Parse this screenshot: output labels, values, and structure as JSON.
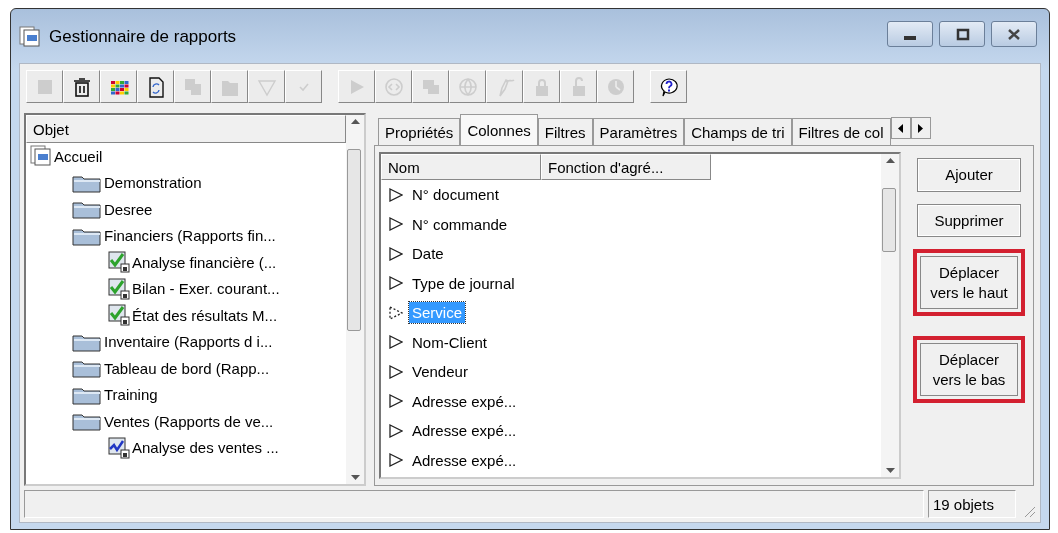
{
  "window": {
    "title": "Gestionnaire de rapports",
    "controls": [
      {
        "kind": "minimize"
      },
      {
        "kind": "maximize"
      },
      {
        "kind": "close"
      }
    ]
  },
  "toolbar": [
    [
      {
        "kind": "stop",
        "disabled": true
      },
      {
        "kind": "trash",
        "disabled": false
      },
      {
        "kind": "grid",
        "disabled": false
      },
      {
        "kind": "refresh",
        "disabled": false
      },
      {
        "kind": "copy",
        "disabled": true
      },
      {
        "kind": "paste",
        "disabled": true
      },
      {
        "kind": "filter",
        "disabled": true
      },
      {
        "kind": "check",
        "disabled": true
      }
    ],
    [
      {
        "kind": "play",
        "disabled": true
      },
      {
        "kind": "code",
        "disabled": true
      },
      {
        "kind": "windows",
        "disabled": true
      },
      {
        "kind": "globe",
        "disabled": true
      },
      {
        "kind": "pen",
        "disabled": true
      },
      {
        "kind": "lock",
        "disabled": true
      },
      {
        "kind": "unlock",
        "disabled": true
      },
      {
        "kind": "clock",
        "disabled": true
      }
    ],
    [
      {
        "kind": "help",
        "disabled": false
      }
    ]
  ],
  "tree": {
    "header": "Objet",
    "items": [
      {
        "label": "Accueil",
        "kind": "root",
        "children": [
          {
            "label": "Demonstration",
            "kind": "folder"
          },
          {
            "label": "Desree",
            "kind": "folder"
          },
          {
            "label": "Financiers (Rapports fin...",
            "kind": "folder",
            "children": [
              {
                "label": "Analyse financière (...",
                "kind": "report"
              },
              {
                "label": "Bilan - Exer. courant...",
                "kind": "report"
              },
              {
                "label": "État des résultats M...",
                "kind": "report"
              }
            ]
          },
          {
            "label": "Inventaire (Rapports d i...",
            "kind": "folder"
          },
          {
            "label": "Tableau de bord (Rapp...",
            "kind": "folder"
          },
          {
            "label": "Training",
            "kind": "folder"
          },
          {
            "label": "Ventes (Rapports de ve...",
            "kind": "folder",
            "children": [
              {
                "label": "Analyse des ventes ...",
                "kind": "chart"
              }
            ]
          }
        ]
      }
    ]
  },
  "tabs": [
    {
      "label": "Propriétés",
      "selected": false
    },
    {
      "label": "Colonnes",
      "selected": true
    },
    {
      "label": "Filtres",
      "selected": false
    },
    {
      "label": "Paramètres",
      "selected": false
    },
    {
      "label": "Champs de tri",
      "selected": false
    },
    {
      "label": "Filtres de col",
      "selected": false
    }
  ],
  "columns": {
    "headers": [
      "Nom",
      "Fonction d'agré..."
    ],
    "rows": [
      {
        "name": "N° document",
        "selected": false
      },
      {
        "name": "N° commande",
        "selected": false
      },
      {
        "name": "Date",
        "selected": false
      },
      {
        "name": "Type de journal",
        "selected": false
      },
      {
        "name": "Service",
        "selected": true
      },
      {
        "name": "Nom-Client",
        "selected": false
      },
      {
        "name": "Vendeur",
        "selected": false
      },
      {
        "name": "Adresse expé...",
        "selected": false
      },
      {
        "name": "Adresse expé...",
        "selected": false
      },
      {
        "name": "Adresse expé...",
        "selected": false
      }
    ]
  },
  "buttons": [
    {
      "label": "Ajouter",
      "highlighted": false
    },
    {
      "label": "Supprimer",
      "highlighted": false
    },
    {
      "label": "Déplacer vers le haut",
      "highlighted": true
    },
    {
      "label": "Déplacer vers le bas",
      "highlighted": true
    }
  ],
  "status_bar": {
    "count": "19 objets"
  }
}
